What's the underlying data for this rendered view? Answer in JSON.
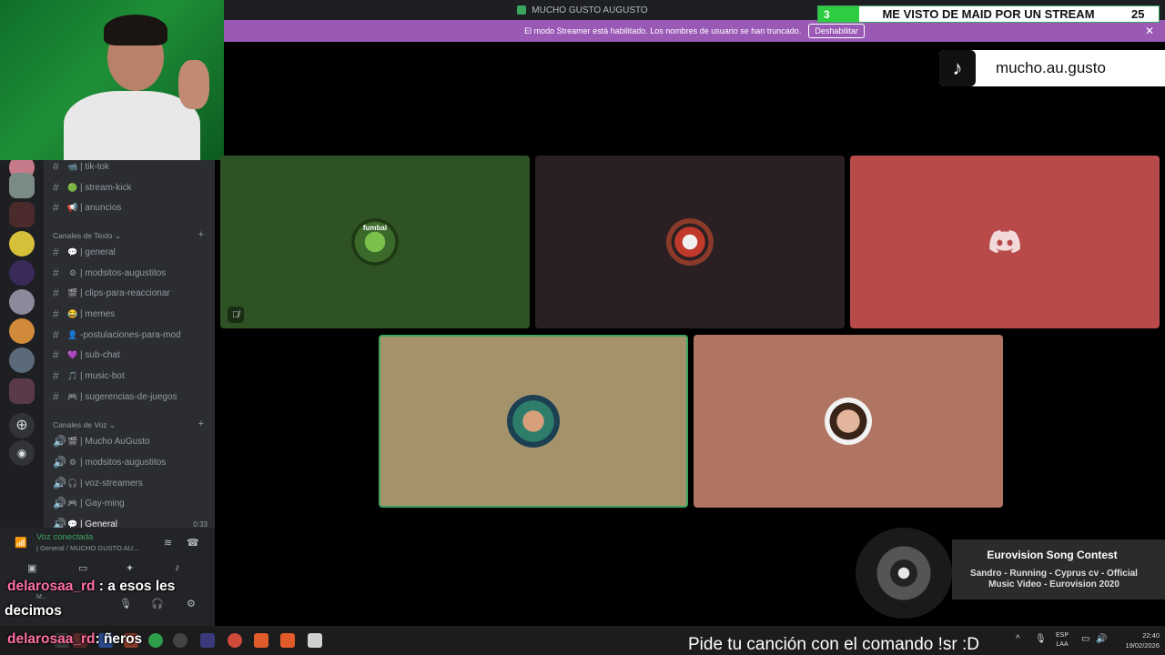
{
  "window": {
    "title": "MUCHO GUSTO AUGUSTO"
  },
  "banner": {
    "text": "El modo Streamer está habilitado. Los nombres de usuario se han truncado.",
    "button": "Deshabilitar",
    "close": "✕"
  },
  "goal": {
    "current": "3",
    "label": "ME VISTO DE MAID POR UN STREAM",
    "target": "25",
    "progress": 0.12
  },
  "tiktok": {
    "icon": "tiktok-icon",
    "handle": "mucho.au.gusto"
  },
  "channels": {
    "top": [
      {
        "emoji": "📹",
        "name": "| tik-tok"
      },
      {
        "emoji": "🟢",
        "name": "| stream-kick"
      },
      {
        "emoji": "📢",
        "name": "| anuncios"
      }
    ],
    "text_category": "Canales de Texto",
    "text": [
      {
        "emoji": "💬",
        "name": "| general"
      },
      {
        "emoji": "⚙",
        "name": "| modsitos-augustitos"
      },
      {
        "emoji": "🎬",
        "name": "| clips-para-reaccionar"
      },
      {
        "emoji": "😂",
        "name": "| memes"
      },
      {
        "emoji": "👤",
        "name": "-postulaciones-para-mod"
      },
      {
        "emoji": "💜",
        "name": "| sub-chat"
      },
      {
        "emoji": "🎵",
        "name": "| music-bot"
      },
      {
        "emoji": "🎮",
        "name": "| sugerencias-de-juegos"
      }
    ],
    "voice_category": "Canales de Voz",
    "voice": [
      {
        "emoji": "🎬",
        "name": "| Mucho AuGusto"
      },
      {
        "emoji": "⚙",
        "name": "| modsitos-augustitos"
      },
      {
        "emoji": "🎧",
        "name": "| voz-streamers"
      },
      {
        "emoji": "🎮",
        "name": "| Gay-ming"
      },
      {
        "emoji": "💬",
        "name": "| General"
      }
    ],
    "voice_time": "0:33"
  },
  "voice_panel": {
    "status": "Voz conectada",
    "location": "| General / MUCHO GUSTO AU...",
    "user": "M..."
  },
  "tiles": [
    {
      "color": "#2f5224",
      "avatar": "fumbal-avatar",
      "avatar_text": "fumbal",
      "muted": true
    },
    {
      "color": "#2a1f22",
      "avatar": "pixel-avatar",
      "muted": false
    },
    {
      "color": "#b84a4a",
      "avatar": "discord-logo-icon",
      "muted": false
    },
    {
      "color": "#a4936a",
      "avatar": "anime-avatar",
      "muted": false,
      "speaking": true
    },
    {
      "color": "#b07462",
      "avatar": "woman-avatar",
      "muted": false
    }
  ],
  "now_playing": {
    "title": "Eurovision Song Contest",
    "subtitle": "Sandro - Running - Cyprus cv - Official Music Video - Eurovision 2020"
  },
  "chat": [
    {
      "user": "delarosaa_rd",
      "sep": " : ",
      "message": "a esos les",
      "message_line2": "decimos"
    },
    {
      "user": "delarosaa_rd",
      "sep": ": ",
      "message": "ñeros"
    }
  ],
  "command_text": "Pide tu canción con el comando !sr :D",
  "tray": {
    "lang": "ESP",
    "layout": "LAA",
    "time": "22:40",
    "date": "19/02/2026"
  }
}
